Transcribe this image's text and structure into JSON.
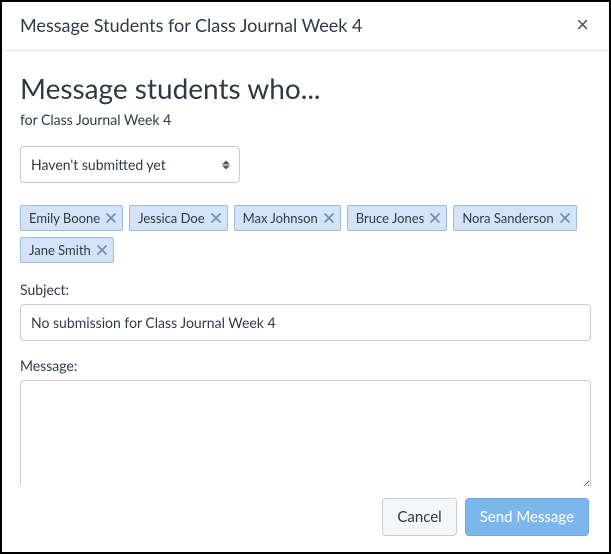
{
  "modal": {
    "title": "Message Students for Class Journal Week 4",
    "close_label": "×"
  },
  "heading": "Message students who...",
  "subheading": "for Class Journal Week 4",
  "criteria": {
    "selected": "Haven't submitted yet"
  },
  "recipients": [
    {
      "name": "Emily Boone"
    },
    {
      "name": "Jessica Doe"
    },
    {
      "name": "Max Johnson"
    },
    {
      "name": "Bruce Jones"
    },
    {
      "name": "Nora Sanderson"
    },
    {
      "name": "Jane Smith"
    }
  ],
  "subject": {
    "label": "Subject:",
    "value": "No submission for Class Journal Week 4"
  },
  "message": {
    "label": "Message:",
    "value": ""
  },
  "footer": {
    "cancel_label": "Cancel",
    "send_label": "Send Message"
  }
}
